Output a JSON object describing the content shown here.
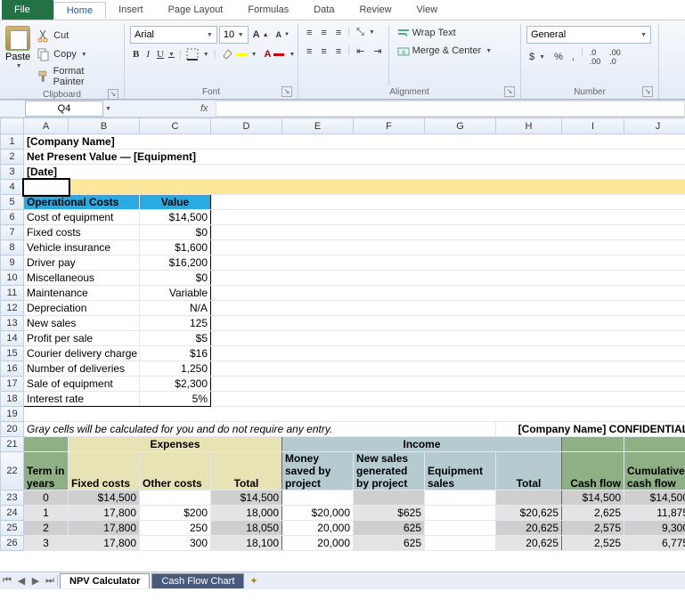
{
  "tabs": {
    "file": "File",
    "home": "Home",
    "insert": "Insert",
    "pagelayout": "Page Layout",
    "formulas": "Formulas",
    "data": "Data",
    "review": "Review",
    "view": "View"
  },
  "clipboard": {
    "paste": "Paste",
    "cut": "Cut",
    "copy": "Copy",
    "fmt": "Format Painter",
    "label": "Clipboard"
  },
  "font": {
    "name": "Arial",
    "size": "10",
    "label": "Font"
  },
  "align": {
    "wrap": "Wrap Text",
    "merge": "Merge & Center",
    "label": "Alignment"
  },
  "number": {
    "format": "General",
    "label": "Number"
  },
  "namebox": "Q4",
  "fx": "fx",
  "cols": [
    "A",
    "B",
    "C",
    "D",
    "E",
    "F",
    "G",
    "H",
    "I",
    "J"
  ],
  "title1": "[Company Name]",
  "title2": "Net Present Value — [Equipment]",
  "title3": "[Date]",
  "oc": {
    "h1": "Operational Costs",
    "h2": "Value",
    "rows": [
      {
        "l": "Cost of equipment",
        "v": "$14,500"
      },
      {
        "l": "Fixed costs",
        "v": "$0"
      },
      {
        "l": "Vehicle insurance",
        "v": "$1,600"
      },
      {
        "l": "Driver pay",
        "v": "$16,200"
      },
      {
        "l": "Miscellaneous",
        "v": "$0"
      },
      {
        "l": "Maintenance",
        "v": "Variable"
      },
      {
        "l": "Depreciation",
        "v": "N/A"
      },
      {
        "l": "New sales",
        "v": "125"
      },
      {
        "l": "Profit per sale",
        "v": "$5"
      },
      {
        "l": "Courier delivery charge",
        "v": "$16"
      },
      {
        "l": "Number of deliveries",
        "v": "1,250"
      },
      {
        "l": "Sale of equipment",
        "v": "$2,300"
      },
      {
        "l": "Interest rate",
        "v": "5%"
      }
    ]
  },
  "note": "Gray cells will be calculated for you and do not require any entry.",
  "conf": "[Company Name] CONFIDENTIAL",
  "sect": {
    "exp": "Expenses",
    "inc": "Income"
  },
  "h": {
    "term": "Term in years",
    "fixed": "Fixed costs",
    "other": "Other costs",
    "total": "Total",
    "msaved": "Money saved by project",
    "nsales": "New sales generated by project",
    "eqsales": "Equipment sales",
    "total2": "Total",
    "cf": "Cash flow",
    "ccf": "Cumulative cash flow"
  },
  "data": [
    {
      "t": "0",
      "fc": "$14,500",
      "oc": "",
      "tot": "$14,500",
      "ms": "",
      "ns": "",
      "es": "",
      "it": "",
      "cf": "$14,500",
      "ccf": "$14,500"
    },
    {
      "t": "1",
      "fc": "17,800",
      "oc": "$200",
      "tot": "18,000",
      "ms": "$20,000",
      "ns": "$625",
      "es": "",
      "it": "$20,625",
      "cf": "2,625",
      "ccf": "11,875"
    },
    {
      "t": "2",
      "fc": "17,800",
      "oc": "250",
      "tot": "18,050",
      "ms": "20,000",
      "ns": "625",
      "es": "",
      "it": "20,625",
      "cf": "2,575",
      "ccf": "9,300"
    },
    {
      "t": "3",
      "fc": "17,800",
      "oc": "300",
      "tot": "18,100",
      "ms": "20,000",
      "ns": "625",
      "es": "",
      "it": "20,625",
      "cf": "2,525",
      "ccf": "6,775"
    }
  ],
  "sheets": {
    "s1": "NPV Calculator",
    "s2": "Cash Flow Chart"
  }
}
